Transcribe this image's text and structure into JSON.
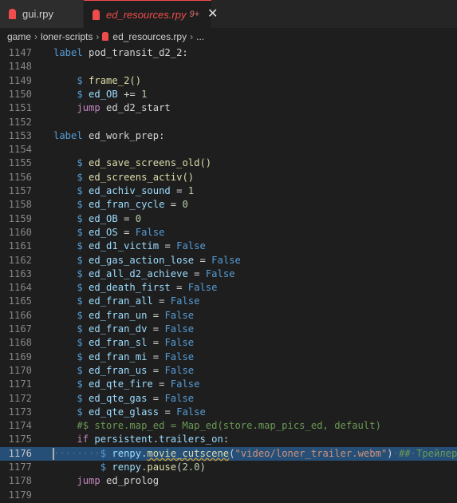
{
  "tabs": [
    {
      "label": "gui.rpy",
      "icon": "renpy-file-icon"
    },
    {
      "label": "ed_resources.rpy",
      "badge": "9+",
      "close": "✕",
      "icon": "renpy-file-icon",
      "color": "#f14c4c"
    }
  ],
  "breadcrumb": {
    "parts": [
      "game",
      "loner-scripts",
      "ed_resources.rpy",
      "..."
    ],
    "separator": "›"
  },
  "theme": {
    "background": "#1e1e1e",
    "keyword": "#569cd6",
    "control": "#c586c0",
    "function": "#dcdcaa",
    "variable": "#9cdcfe",
    "string": "#ce9178",
    "number": "#b5cea8",
    "comment": "#6a9955",
    "selection": "#264f78"
  },
  "editor": {
    "current_line": "1176",
    "lines": [
      {
        "num": "1147",
        "tokens": [
          {
            "t": "label",
            "c": "kw"
          },
          {
            "t": " pod_transit_d2_2:",
            "c": "plain"
          }
        ]
      },
      {
        "num": "1148",
        "tokens": []
      },
      {
        "num": "1149",
        "tokens": [
          {
            "t": "    ",
            "c": "plain"
          },
          {
            "t": "$",
            "c": "dol"
          },
          {
            "t": " ",
            "c": "plain"
          },
          {
            "t": "frame_2",
            "c": "fn"
          },
          {
            "t": "()",
            "c": "fn"
          }
        ]
      },
      {
        "num": "1150",
        "tokens": [
          {
            "t": "    ",
            "c": "plain"
          },
          {
            "t": "$",
            "c": "dol"
          },
          {
            "t": " ",
            "c": "plain"
          },
          {
            "t": "ed_OB",
            "c": "var"
          },
          {
            "t": " += ",
            "c": "plain"
          },
          {
            "t": "1",
            "c": "num"
          }
        ]
      },
      {
        "num": "1151",
        "tokens": [
          {
            "t": "    ",
            "c": "plain"
          },
          {
            "t": "jump",
            "c": "ctl"
          },
          {
            "t": " ed_d2_start",
            "c": "plain"
          }
        ]
      },
      {
        "num": "1152",
        "tokens": []
      },
      {
        "num": "1153",
        "tokens": [
          {
            "t": "label",
            "c": "kw"
          },
          {
            "t": " ed_work_prep:",
            "c": "plain"
          }
        ]
      },
      {
        "num": "1154",
        "tokens": []
      },
      {
        "num": "1155",
        "tokens": [
          {
            "t": "    ",
            "c": "plain"
          },
          {
            "t": "$",
            "c": "dol"
          },
          {
            "t": " ",
            "c": "plain"
          },
          {
            "t": "ed_save_screens_old",
            "c": "fn"
          },
          {
            "t": "()",
            "c": "fn"
          }
        ]
      },
      {
        "num": "1156",
        "tokens": [
          {
            "t": "    ",
            "c": "plain"
          },
          {
            "t": "$",
            "c": "dol"
          },
          {
            "t": " ",
            "c": "plain"
          },
          {
            "t": "ed_screens_activ",
            "c": "fn"
          },
          {
            "t": "()",
            "c": "fn"
          }
        ]
      },
      {
        "num": "1157",
        "tokens": [
          {
            "t": "    ",
            "c": "plain"
          },
          {
            "t": "$",
            "c": "dol"
          },
          {
            "t": " ",
            "c": "plain"
          },
          {
            "t": "ed_achiv_sound",
            "c": "var"
          },
          {
            "t": " = ",
            "c": "plain"
          },
          {
            "t": "1",
            "c": "num"
          }
        ]
      },
      {
        "num": "1158",
        "tokens": [
          {
            "t": "    ",
            "c": "plain"
          },
          {
            "t": "$",
            "c": "dol"
          },
          {
            "t": " ",
            "c": "plain"
          },
          {
            "t": "ed_fran_cycle",
            "c": "var"
          },
          {
            "t": " = ",
            "c": "plain"
          },
          {
            "t": "0",
            "c": "num"
          }
        ]
      },
      {
        "num": "1159",
        "tokens": [
          {
            "t": "    ",
            "c": "plain"
          },
          {
            "t": "$",
            "c": "dol"
          },
          {
            "t": " ",
            "c": "plain"
          },
          {
            "t": "ed_OB",
            "c": "var"
          },
          {
            "t": " = ",
            "c": "plain"
          },
          {
            "t": "0",
            "c": "num"
          }
        ]
      },
      {
        "num": "1160",
        "tokens": [
          {
            "t": "    ",
            "c": "plain"
          },
          {
            "t": "$",
            "c": "dol"
          },
          {
            "t": " ",
            "c": "plain"
          },
          {
            "t": "ed_OS",
            "c": "var"
          },
          {
            "t": " = ",
            "c": "plain"
          },
          {
            "t": "False",
            "c": "kw"
          }
        ]
      },
      {
        "num": "1161",
        "tokens": [
          {
            "t": "    ",
            "c": "plain"
          },
          {
            "t": "$",
            "c": "dol"
          },
          {
            "t": " ",
            "c": "plain"
          },
          {
            "t": "ed_d1_victim",
            "c": "var"
          },
          {
            "t": " = ",
            "c": "plain"
          },
          {
            "t": "False",
            "c": "kw"
          }
        ]
      },
      {
        "num": "1162",
        "tokens": [
          {
            "t": "    ",
            "c": "plain"
          },
          {
            "t": "$",
            "c": "dol"
          },
          {
            "t": " ",
            "c": "plain"
          },
          {
            "t": "ed_gas_action_lose",
            "c": "var"
          },
          {
            "t": " = ",
            "c": "plain"
          },
          {
            "t": "False",
            "c": "kw"
          }
        ]
      },
      {
        "num": "1163",
        "tokens": [
          {
            "t": "    ",
            "c": "plain"
          },
          {
            "t": "$",
            "c": "dol"
          },
          {
            "t": " ",
            "c": "plain"
          },
          {
            "t": "ed_all_d2_achieve",
            "c": "var"
          },
          {
            "t": " = ",
            "c": "plain"
          },
          {
            "t": "False",
            "c": "kw"
          }
        ]
      },
      {
        "num": "1164",
        "tokens": [
          {
            "t": "    ",
            "c": "plain"
          },
          {
            "t": "$",
            "c": "dol"
          },
          {
            "t": " ",
            "c": "plain"
          },
          {
            "t": "ed_death_first",
            "c": "var"
          },
          {
            "t": " = ",
            "c": "plain"
          },
          {
            "t": "False",
            "c": "kw"
          }
        ]
      },
      {
        "num": "1165",
        "tokens": [
          {
            "t": "    ",
            "c": "plain"
          },
          {
            "t": "$",
            "c": "dol"
          },
          {
            "t": " ",
            "c": "plain"
          },
          {
            "t": "ed_fran_all",
            "c": "var"
          },
          {
            "t": " = ",
            "c": "plain"
          },
          {
            "t": "False",
            "c": "kw"
          }
        ]
      },
      {
        "num": "1166",
        "tokens": [
          {
            "t": "    ",
            "c": "plain"
          },
          {
            "t": "$",
            "c": "dol"
          },
          {
            "t": " ",
            "c": "plain"
          },
          {
            "t": "ed_fran_un",
            "c": "var"
          },
          {
            "t": " = ",
            "c": "plain"
          },
          {
            "t": "False",
            "c": "kw"
          }
        ]
      },
      {
        "num": "1167",
        "tokens": [
          {
            "t": "    ",
            "c": "plain"
          },
          {
            "t": "$",
            "c": "dol"
          },
          {
            "t": " ",
            "c": "plain"
          },
          {
            "t": "ed_fran_dv",
            "c": "var"
          },
          {
            "t": " = ",
            "c": "plain"
          },
          {
            "t": "False",
            "c": "kw"
          }
        ]
      },
      {
        "num": "1168",
        "tokens": [
          {
            "t": "    ",
            "c": "plain"
          },
          {
            "t": "$",
            "c": "dol"
          },
          {
            "t": " ",
            "c": "plain"
          },
          {
            "t": "ed_fran_sl",
            "c": "var"
          },
          {
            "t": " = ",
            "c": "plain"
          },
          {
            "t": "False",
            "c": "kw"
          }
        ]
      },
      {
        "num": "1169",
        "tokens": [
          {
            "t": "    ",
            "c": "plain"
          },
          {
            "t": "$",
            "c": "dol"
          },
          {
            "t": " ",
            "c": "plain"
          },
          {
            "t": "ed_fran_mi",
            "c": "var"
          },
          {
            "t": " = ",
            "c": "plain"
          },
          {
            "t": "False",
            "c": "kw"
          }
        ]
      },
      {
        "num": "1170",
        "tokens": [
          {
            "t": "    ",
            "c": "plain"
          },
          {
            "t": "$",
            "c": "dol"
          },
          {
            "t": " ",
            "c": "plain"
          },
          {
            "t": "ed_fran_us",
            "c": "var"
          },
          {
            "t": " = ",
            "c": "plain"
          },
          {
            "t": "False",
            "c": "kw"
          }
        ]
      },
      {
        "num": "1171",
        "tokens": [
          {
            "t": "    ",
            "c": "plain"
          },
          {
            "t": "$",
            "c": "dol"
          },
          {
            "t": " ",
            "c": "plain"
          },
          {
            "t": "ed_qte_fire",
            "c": "var"
          },
          {
            "t": " = ",
            "c": "plain"
          },
          {
            "t": "False",
            "c": "kw"
          }
        ]
      },
      {
        "num": "1172",
        "tokens": [
          {
            "t": "    ",
            "c": "plain"
          },
          {
            "t": "$",
            "c": "dol"
          },
          {
            "t": " ",
            "c": "plain"
          },
          {
            "t": "ed_qte_gas",
            "c": "var"
          },
          {
            "t": " = ",
            "c": "plain"
          },
          {
            "t": "False",
            "c": "kw"
          }
        ]
      },
      {
        "num": "1173",
        "tokens": [
          {
            "t": "    ",
            "c": "plain"
          },
          {
            "t": "$",
            "c": "dol"
          },
          {
            "t": " ",
            "c": "plain"
          },
          {
            "t": "ed_qte_glass",
            "c": "var"
          },
          {
            "t": " = ",
            "c": "plain"
          },
          {
            "t": "False",
            "c": "kw"
          }
        ]
      },
      {
        "num": "1174",
        "tokens": [
          {
            "t": "    ",
            "c": "plain"
          },
          {
            "t": "#$ store.map_ed = Map_ed(store.map_pics_ed, default)",
            "c": "cmt"
          }
        ]
      },
      {
        "num": "1175",
        "tokens": [
          {
            "t": "    ",
            "c": "plain"
          },
          {
            "t": "if",
            "c": "ctl"
          },
          {
            "t": " ",
            "c": "plain"
          },
          {
            "t": "persistent",
            "c": "var"
          },
          {
            "t": ".",
            "c": "plain"
          },
          {
            "t": "trailers_on",
            "c": "var"
          },
          {
            "t": ":",
            "c": "plain"
          }
        ]
      },
      {
        "num": "1176",
        "highlight": true,
        "tokens": [
          {
            "t": "········",
            "c": "wsp"
          },
          {
            "t": "$",
            "c": "dol"
          },
          {
            "t": " ",
            "c": "plain"
          },
          {
            "t": "renpy",
            "c": "var"
          },
          {
            "t": ".",
            "c": "plain"
          },
          {
            "t": "movie_cutscene",
            "c": "fn sq"
          },
          {
            "t": "(",
            "c": "plain"
          },
          {
            "t": "\"video/loner_trailer.webm\"",
            "c": "str"
          },
          {
            "t": ")",
            "c": "plain"
          },
          {
            "t": "·",
            "c": "wsp"
          },
          {
            "t": "##",
            "c": "cmt"
          },
          {
            "t": "·",
            "c": "wsp"
          },
          {
            "t": "Трейлер",
            "c": "cmt"
          }
        ]
      },
      {
        "num": "1177",
        "tokens": [
          {
            "t": "        ",
            "c": "plain"
          },
          {
            "t": "$",
            "c": "dol"
          },
          {
            "t": " ",
            "c": "plain"
          },
          {
            "t": "renpy",
            "c": "var"
          },
          {
            "t": ".",
            "c": "plain"
          },
          {
            "t": "pause",
            "c": "fn"
          },
          {
            "t": "(",
            "c": "plain"
          },
          {
            "t": "2.0",
            "c": "num"
          },
          {
            "t": ")",
            "c": "plain"
          }
        ]
      },
      {
        "num": "1178",
        "tokens": [
          {
            "t": "    ",
            "c": "plain"
          },
          {
            "t": "jump",
            "c": "ctl"
          },
          {
            "t": " ed_prolog",
            "c": "plain"
          }
        ]
      },
      {
        "num": "1179",
        "tokens": []
      }
    ]
  }
}
